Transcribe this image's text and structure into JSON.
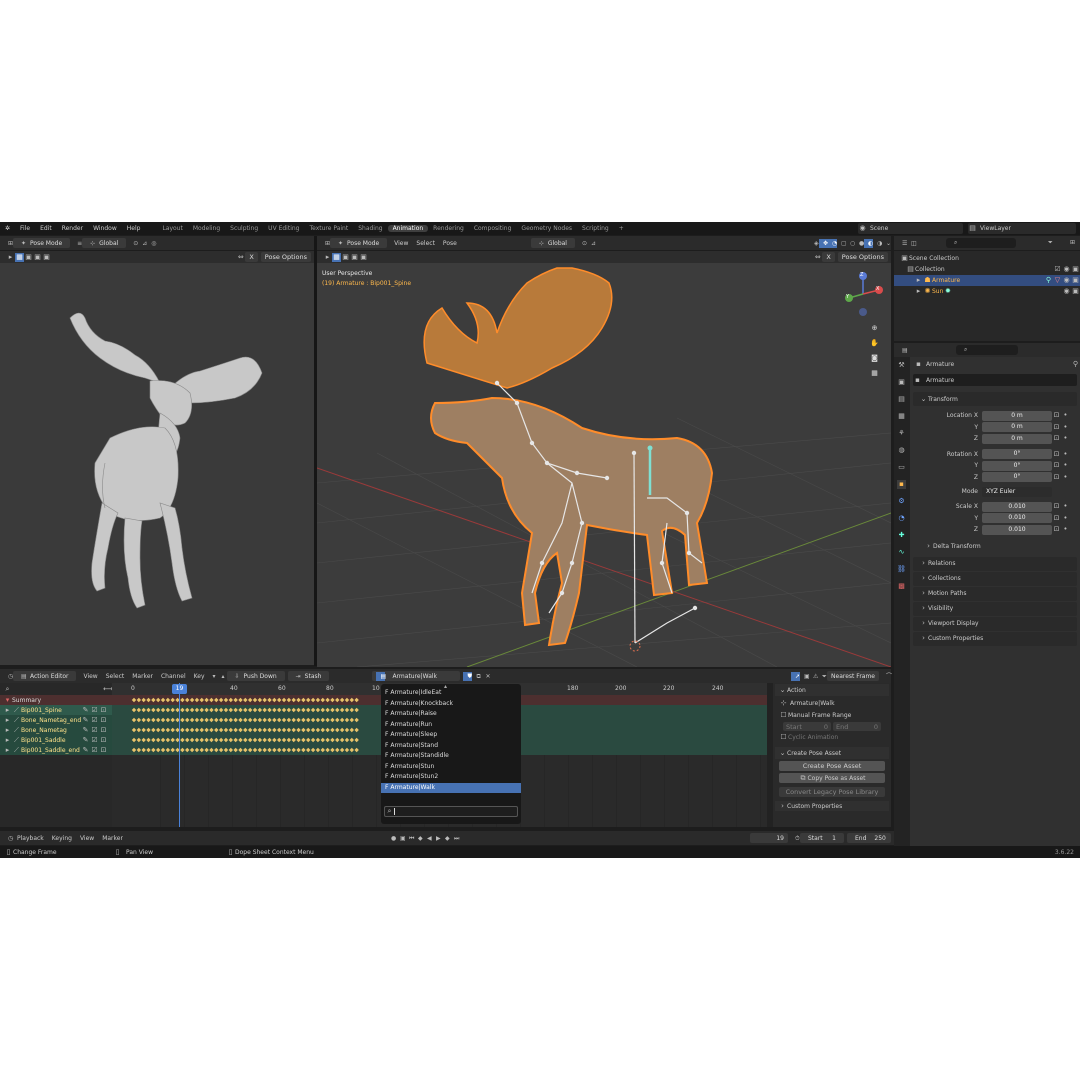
{
  "menu": {
    "items": [
      "File",
      "Edit",
      "Render",
      "Window",
      "Help"
    ],
    "workspaces": [
      "Layout",
      "Modeling",
      "Sculpting",
      "UV Editing",
      "Texture Paint",
      "Shading",
      "Animation",
      "Rendering",
      "Compositing",
      "Geometry Nodes",
      "Scripting"
    ],
    "active_workspace": "Animation",
    "add_tab": "+",
    "scene": "Scene",
    "view_layer": "ViewLayer"
  },
  "left_viewport": {
    "mode": "Pose Mode",
    "orientation": "Global",
    "pose_options": "Pose Options",
    "x_mirror": "X"
  },
  "main_viewport": {
    "mode": "Pose Mode",
    "menus": [
      "View",
      "Select",
      "Pose"
    ],
    "orientation": "Global",
    "pose_options": "Pose Options",
    "x_mirror": "X",
    "perspective_label": "User Perspective",
    "active_bone_label": "(19) Armature : Bip001_Spine",
    "gizmo_axes": {
      "z": "Z",
      "y": "Y",
      "x": "X"
    }
  },
  "outliner": {
    "search_placeholder": "",
    "rows": [
      {
        "label": "Scene Collection"
      },
      {
        "label": "Collection"
      },
      {
        "label": "Armature"
      },
      {
        "label": "Sun"
      }
    ]
  },
  "properties": {
    "object_name": "Armature",
    "data_name": "Armature",
    "sections": {
      "transform": "Transform",
      "delta_transform": "Delta Transform",
      "relations": "Relations",
      "collections": "Collections",
      "motion_paths": "Motion Paths",
      "visibility": "Visibility",
      "viewport_display": "Viewport Display",
      "custom_properties": "Custom Properties"
    },
    "location": {
      "label": "Location X",
      "y_label": "Y",
      "z_label": "Z",
      "x": "0 m",
      "y": "0 m",
      "z": "0 m"
    },
    "rotation": {
      "label": "Rotation X",
      "y_label": "Y",
      "z_label": "Z",
      "x": "0°",
      "y": "0°",
      "z": "0°"
    },
    "mode": {
      "label": "Mode",
      "value": "XYZ Euler"
    },
    "scale": {
      "label": "Scale X",
      "y_label": "Y",
      "z_label": "Z",
      "x": "0.010",
      "y": "0.010",
      "z": "0.010"
    }
  },
  "action_editor": {
    "editor_name": "Action Editor",
    "menus": [
      "View",
      "Select",
      "Marker",
      "Channel",
      "Key"
    ],
    "push_down": "Push Down",
    "stash": "Stash",
    "action_name": "Armature|Walk",
    "snap": "Nearest Frame",
    "current_frame": "19",
    "ruler": [
      "0",
      "19",
      "40",
      "60",
      "80",
      "10",
      "180",
      "200",
      "220",
      "240"
    ],
    "channels": [
      {
        "name": "Summary"
      },
      {
        "name": "Bip001_Spine"
      },
      {
        "name": "Bone_Nametag_end"
      },
      {
        "name": "Bone_Nametag"
      },
      {
        "name": "Bip001_Saddle"
      },
      {
        "name": "Bip001_Saddle_end"
      }
    ]
  },
  "action_dropdown": {
    "items": [
      "F Armature|IdleEat",
      "F Armature|Knockback",
      "F Armature|Raise",
      "F Armature|Run",
      "F Armature|Sleep",
      "F Armature|Stand",
      "F Armature|Standidle",
      "F Armature|Stun",
      "F Armature|Stun2",
      "F Armature|Walk"
    ],
    "selected_index": 9,
    "search_value": ""
  },
  "action_sidebar": {
    "action_title": "Action",
    "action_value": "Armature|Walk",
    "manual_frame_range": "Manual Frame Range",
    "start_label": "Start",
    "start_value": "0",
    "end_label": "End",
    "end_value": "0",
    "cyclic": "Cyclic Animation",
    "pose_asset_title": "Create Pose Asset",
    "create_pose_asset": "Create Pose Asset",
    "copy_pose_asset": "Copy Pose as Asset",
    "convert_legacy": "Convert Legacy Pose Library",
    "custom_properties": "Custom Properties"
  },
  "timeline": {
    "menus": [
      "Playback",
      "Keying",
      "View",
      "Marker"
    ],
    "current_frame": "19",
    "start_label": "Start",
    "start": "1",
    "end_label": "End",
    "end": "250"
  },
  "statusbar": {
    "change_frame": "Change Frame",
    "pan_view": "Pan View",
    "context_menu": "Dope Sheet Context Menu",
    "version": "3.6.22"
  },
  "colors": {
    "accent": "#4772b3",
    "selection_orange": "#ff8c2a",
    "channel_green": "#2f5a4c",
    "keyframe": "#e8c36a",
    "playhead": "#4a82d9"
  }
}
